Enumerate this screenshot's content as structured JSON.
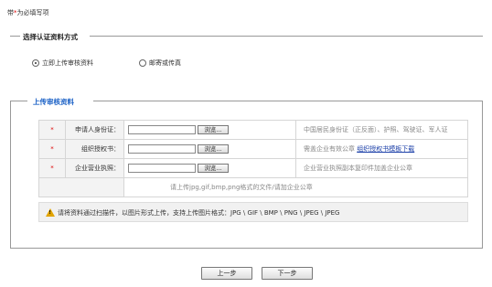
{
  "required_note": {
    "prefix": "带",
    "star": "*",
    "suffix": "为必填写项"
  },
  "method_section": {
    "title": "选择认证资料方式",
    "options": [
      {
        "label": "立即上传审核资料",
        "selected": true
      },
      {
        "label": "邮寄或传真",
        "selected": false
      }
    ]
  },
  "upload_section": {
    "legend": "上传审核资料",
    "rows": [
      {
        "star": "*",
        "label": "申请人身份证：",
        "browse": "浏览...",
        "desc": "中国居民身份证（正反面）、护照、驾驶证、军人证",
        "link": ""
      },
      {
        "star": "*",
        "label": "组织授权书：",
        "browse": "浏览...",
        "desc": "需盖企业有效公章",
        "link": "组织授权书模板下载"
      },
      {
        "star": "*",
        "label": "企业营业执照：",
        "browse": "浏览...",
        "desc": "企业营业执照副本复印件加盖企业公章",
        "link": ""
      }
    ],
    "hint": "请上传jpg,gif,bmp,png格式的文件/请加企业公章",
    "warning": "请将资料通过扫描件，以图片形式上传，支持上传图片格式：JPG \\ GIF \\ BMP \\ PNG \\ JPEG \\ JPEG"
  },
  "buttons": {
    "prev": "上一步",
    "next": "下一步"
  },
  "colors": {
    "accent": "#1b61c6",
    "required": "#dd0000",
    "link": "#1b3fa8"
  }
}
